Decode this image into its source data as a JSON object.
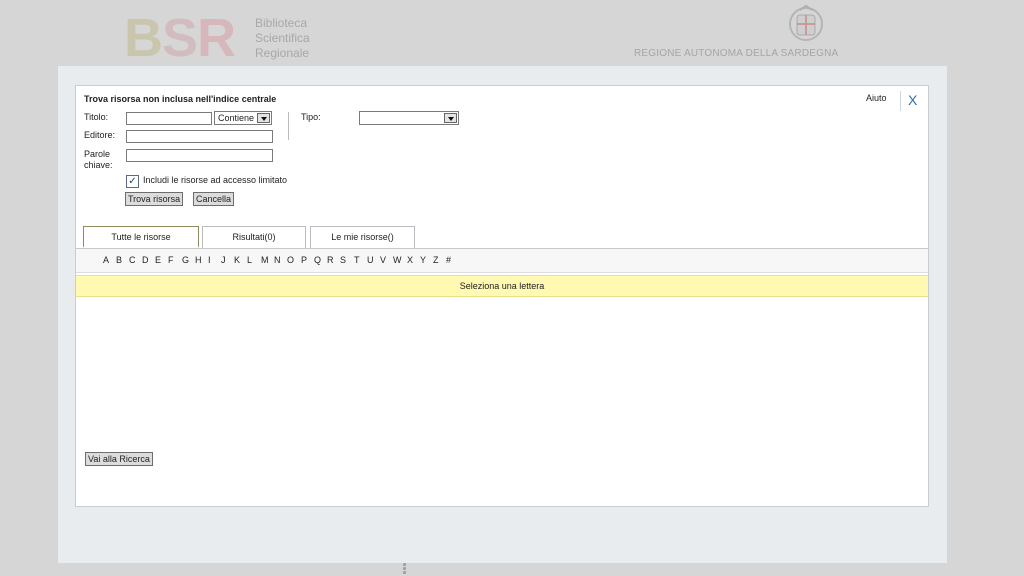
{
  "header": {
    "logo_letters": [
      "B",
      "S",
      "R"
    ],
    "logo_lines": [
      "Biblioteca",
      "Scientifica",
      "Regionale"
    ],
    "region_name": "REGIONE AUTONOMA DELLA SARDEGNA",
    "emblem_icon": "coat-of-arms-icon"
  },
  "dialog": {
    "title": "Trova risorsa non inclusa nell'indice centrale",
    "help_label": "Aiuto",
    "close_label": "X",
    "form": {
      "title_label": "Titolo:",
      "title_value": "",
      "match_select_value": "Contiene",
      "type_label": "Tipo:",
      "type_value": "",
      "publisher_label": "Editore:",
      "publisher_value": "",
      "keywords_label_line1": "Parole",
      "keywords_label_line2": "chiave:",
      "keywords_value": "",
      "restricted_checkbox_label": "Includi le risorse ad accesso limitato",
      "restricted_checked": true,
      "search_button": "Trova risorsa",
      "cancel_button": "Cancella"
    },
    "tabs": [
      {
        "label": "Tutte le risorse",
        "active": true
      },
      {
        "label": "Risultati(0)",
        "active": false
      },
      {
        "label": "Le mie risorse()",
        "active": false
      }
    ],
    "letters": [
      "A",
      "B",
      "C",
      "D",
      "E",
      "F",
      "G",
      "H",
      "I",
      "J",
      "K",
      "L",
      "M",
      "N",
      "O",
      "P",
      "Q",
      "R",
      "S",
      "T",
      "U",
      "V",
      "W",
      "X",
      "Y",
      "Z",
      "#"
    ],
    "notice": "Seleziona una lettera",
    "go_search_button": "Vai alla Ricerca"
  },
  "colors": {
    "background": "#d6d6d6",
    "overlay": "#e9ecef",
    "notice_bg": "#fff9b1",
    "close_accent": "#2f6fa8"
  }
}
